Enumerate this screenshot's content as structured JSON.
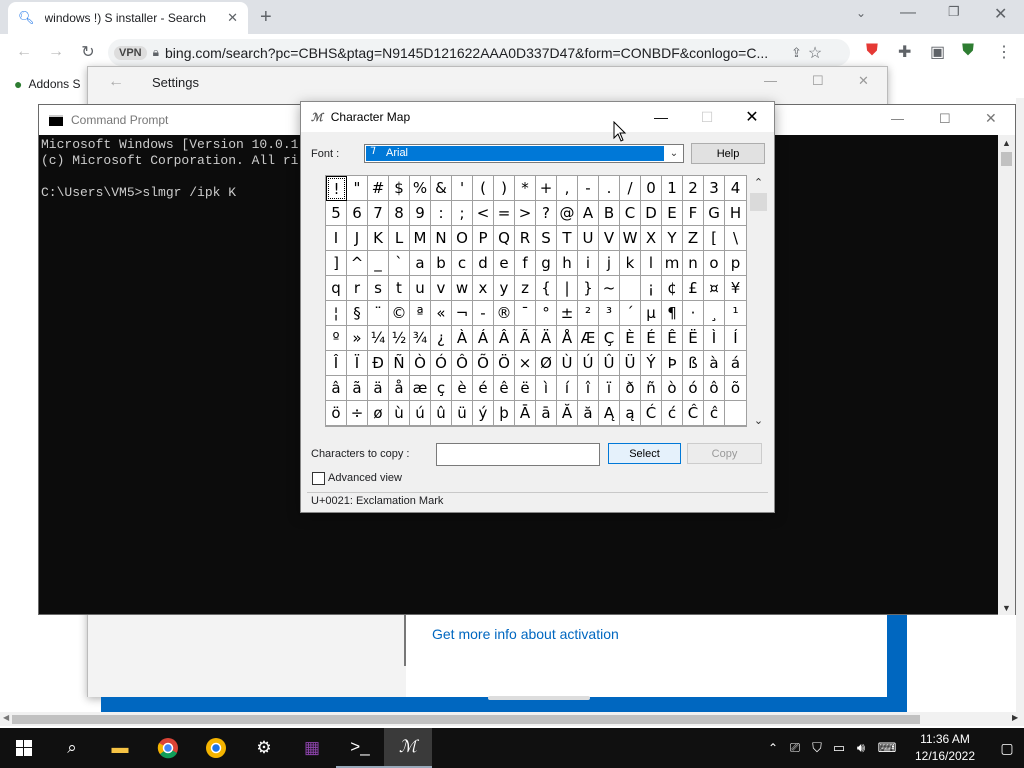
{
  "browser": {
    "tab_title": "windows !) S installer - Search",
    "url": "bing.com/search?pc=CBHS&ptag=N9145D121622AAA0D337D47&form=CONBDF&conlogo=C...",
    "bookmark": "Addons S",
    "vpn_label": "VPN"
  },
  "settings": {
    "title": "Settings",
    "activation_link": "Get more info about activation"
  },
  "cmd": {
    "title": "Command Prompt",
    "lines": "Microsoft Windows [Version 10.0.1\n(c) Microsoft Corporation. All ri\n\nC:\\Users\\VM5>slmgr /ipk K"
  },
  "charmap": {
    "title": "Character Map",
    "font_label": "Font :",
    "font_value": "Arial",
    "help": "Help",
    "copy_label": "Characters to copy :",
    "copy_value": "",
    "select": "Select",
    "copy": "Copy",
    "advanced": "Advanced view",
    "status": "U+0021: Exclamation Mark",
    "rows": [
      [
        "!",
        "\"",
        "#",
        "$",
        "%",
        "&",
        "'",
        "(",
        ")",
        "*",
        "+",
        ",",
        "-",
        ".",
        "/",
        "0",
        "1",
        "2",
        "3",
        "4"
      ],
      [
        "5",
        "6",
        "7",
        "8",
        "9",
        ":",
        ";",
        "<",
        "=",
        ">",
        "?",
        "@",
        "A",
        "B",
        "C",
        "D",
        "E",
        "F",
        "G",
        "H"
      ],
      [
        "I",
        "J",
        "K",
        "L",
        "M",
        "N",
        "O",
        "P",
        "Q",
        "R",
        "S",
        "T",
        "U",
        "V",
        "W",
        "X",
        "Y",
        "Z",
        "[",
        "\\"
      ],
      [
        "]",
        "^",
        "_",
        "`",
        "a",
        "b",
        "c",
        "d",
        "e",
        "f",
        "g",
        "h",
        "i",
        "j",
        "k",
        "l",
        "m",
        "n",
        "o",
        "p"
      ],
      [
        "q",
        "r",
        "s",
        "t",
        "u",
        "v",
        "w",
        "x",
        "y",
        "z",
        "{",
        "|",
        "}",
        "~",
        " ",
        "¡",
        "¢",
        "£",
        "¤",
        "¥"
      ],
      [
        "¦",
        "§",
        "¨",
        "©",
        "ª",
        "«",
        "¬",
        "-",
        "®",
        "¯",
        "°",
        "±",
        "²",
        "³",
        "´",
        "µ",
        "¶",
        "·",
        "¸",
        "¹"
      ],
      [
        "º",
        "»",
        "¼",
        "½",
        "¾",
        "¿",
        "À",
        "Á",
        "Â",
        "Ã",
        "Ä",
        "Å",
        "Æ",
        "Ç",
        "È",
        "É",
        "Ê",
        "Ë",
        "Ì",
        "Í"
      ],
      [
        "Î",
        "Ï",
        "Ð",
        "Ñ",
        "Ò",
        "Ó",
        "Ô",
        "Õ",
        "Ö",
        "×",
        "Ø",
        "Ù",
        "Ú",
        "Û",
        "Ü",
        "Ý",
        "Þ",
        "ß",
        "à",
        "á"
      ],
      [
        "â",
        "ã",
        "ä",
        "å",
        "æ",
        "ç",
        "è",
        "é",
        "ê",
        "ë",
        "ì",
        "í",
        "î",
        "ï",
        "ð",
        "ñ",
        "ò",
        "ó",
        "ô",
        "õ"
      ],
      [
        "ö",
        "÷",
        "ø",
        "ù",
        "ú",
        "û",
        "ü",
        "ý",
        "þ",
        "Ā",
        "ā",
        "Ă",
        "ă",
        "Ą",
        "ą",
        "Ć",
        "ć",
        "Ĉ",
        "ĉ",
        " "
      ]
    ]
  },
  "taskbar": {
    "time": "11:36 AM",
    "date": "12/16/2022"
  }
}
